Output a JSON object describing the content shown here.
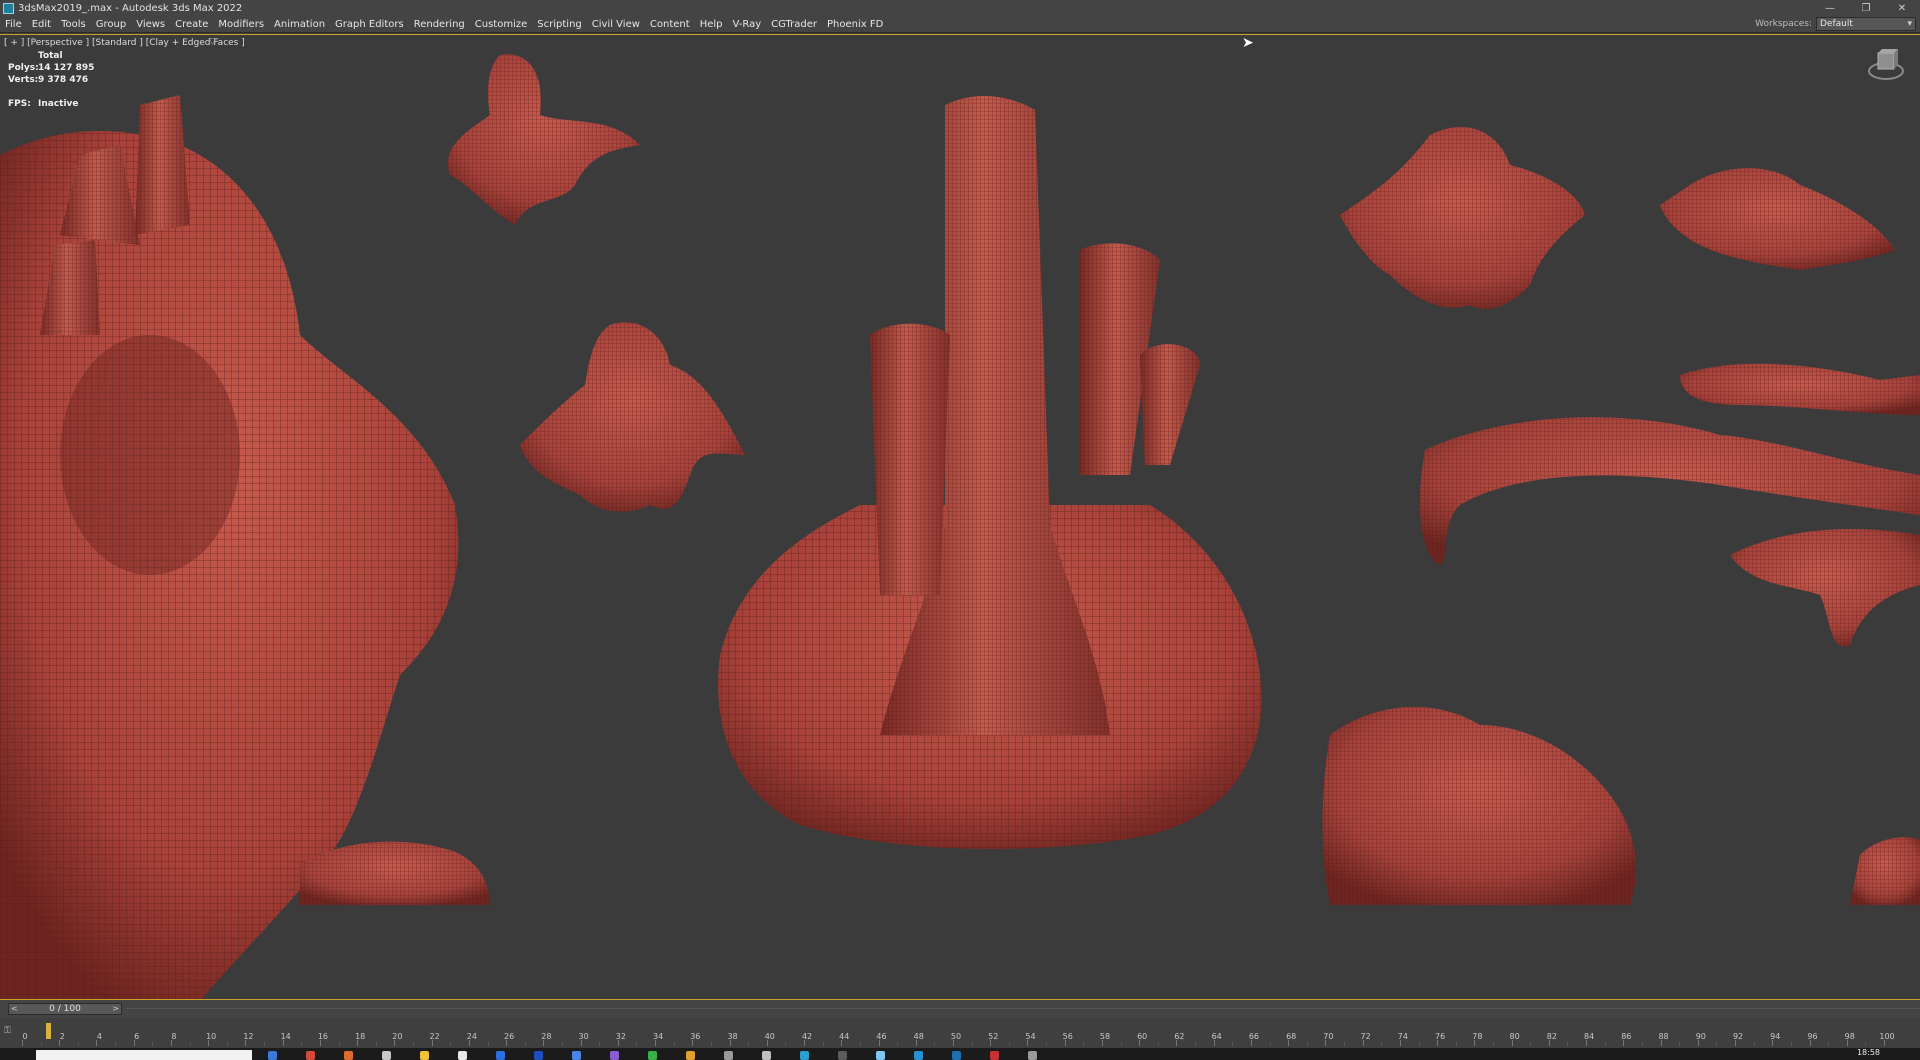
{
  "titlebar": {
    "title": "3dsMax2019_.max - Autodesk 3ds Max 2022",
    "app_icon": "3dsmax-app-icon",
    "controls": [
      "minimize-icon",
      "restore-icon",
      "close-icon"
    ]
  },
  "menubar": {
    "items": [
      "File",
      "Edit",
      "Tools",
      "Group",
      "Views",
      "Create",
      "Modifiers",
      "Animation",
      "Graph Editors",
      "Rendering",
      "Customize",
      "Scripting",
      "Civil View",
      "Content",
      "Help",
      "V-Ray",
      "CGTrader",
      "Phoenix FD"
    ],
    "workspace_label": "Workspaces:",
    "workspace_value": "Default"
  },
  "viewport": {
    "label": "[ + ] [Perspective ] [Standard ] [Clay + Edged Faces ]",
    "stats": {
      "header": "Total",
      "polys_label": "Polys:",
      "polys_value": "14 127 895",
      "verts_label": "Verts:",
      "verts_value": "9 378 476",
      "fps_label": "FPS:",
      "fps_value": "Inactive"
    },
    "mesh_color": "#b5473c",
    "wire_color": "#5a1c18",
    "accent_border": "#c9a227"
  },
  "timeslider": {
    "frame_display": "0 / 100",
    "prev_icon": "chevron-left-icon",
    "next_icon": "chevron-right-icon"
  },
  "trackbar": {
    "start": 0,
    "end": 100,
    "current_frame": 0,
    "labels": [
      "0",
      "2",
      "4",
      "6",
      "8",
      "10",
      "12",
      "14",
      "16",
      "18",
      "20",
      "22",
      "24",
      "26",
      "28",
      "30",
      "32",
      "34",
      "36",
      "38",
      "40",
      "42",
      "44",
      "46",
      "48",
      "50",
      "52",
      "54",
      "56",
      "58",
      "60",
      "62",
      "64",
      "66",
      "68",
      "70",
      "72",
      "74",
      "76",
      "78",
      "80",
      "82",
      "84",
      "86",
      "88",
      "90",
      "92",
      "94",
      "96",
      "98",
      "100"
    ]
  },
  "taskbar": {
    "time": "18:58"
  }
}
